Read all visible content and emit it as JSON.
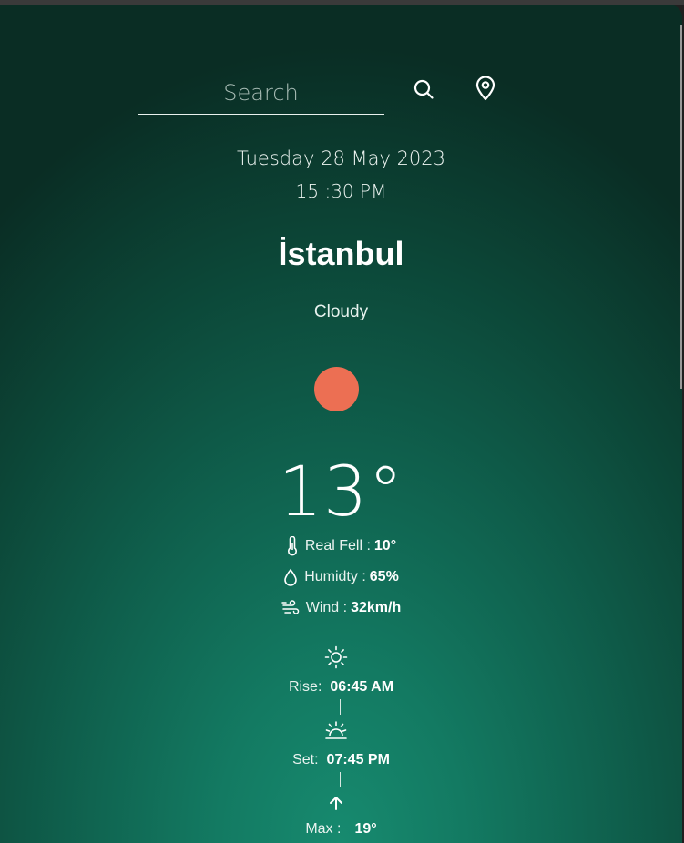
{
  "search": {
    "placeholder": "Search"
  },
  "date": "Tuesday 28 May 2023",
  "time": "15 :30 PM",
  "city": "İstanbul",
  "condition": "Cloudy",
  "temperature": "13°",
  "details": {
    "real_feel": {
      "label": "Real Fell :",
      "value": "10°"
    },
    "humidity": {
      "label": "Humidty :",
      "value": "65%"
    },
    "wind": {
      "label": "Wind :",
      "value": "32km/h"
    }
  },
  "astro": {
    "rise": {
      "label": "Rise:",
      "value": "06:45 AM"
    },
    "set": {
      "label": "Set:",
      "value": "07:45 PM"
    },
    "max": {
      "label": "Max :",
      "value": "19°"
    }
  },
  "colors": {
    "sun": "#ec6f53",
    "bg_dark": "#0a2d24",
    "bg_light": "#178a6f"
  },
  "icons": [
    "search-icon",
    "location-pin-icon",
    "thermometer-icon",
    "droplet-icon",
    "wind-icon",
    "sun-icon",
    "sunset-icon",
    "arrow-up-icon"
  ]
}
